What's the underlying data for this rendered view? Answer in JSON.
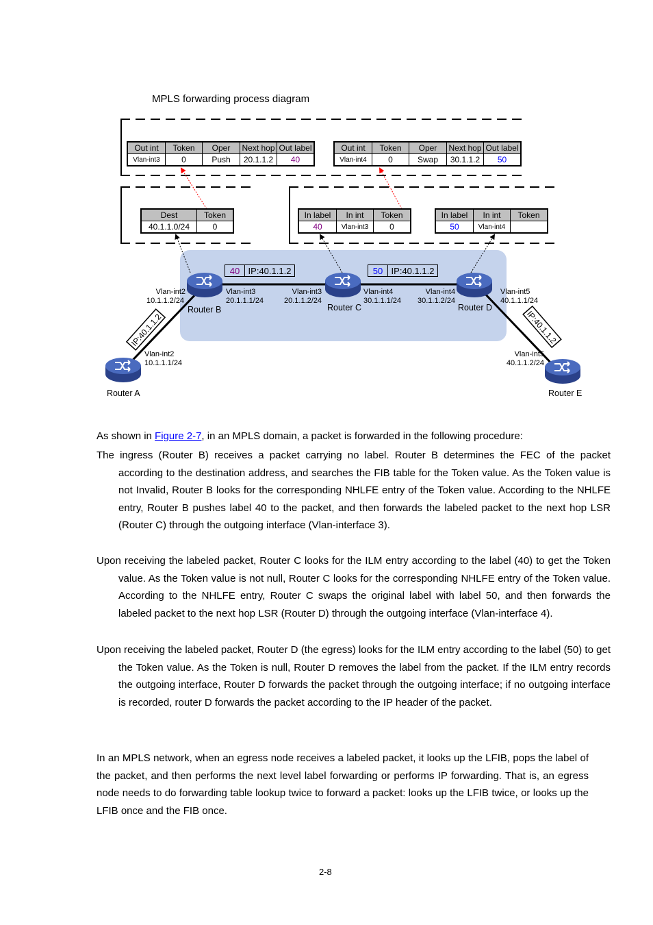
{
  "figure": {
    "caption": "MPLS forwarding process diagram",
    "nhlfe_b": {
      "headers": [
        "Out int",
        "Token",
        "Oper",
        "Next hop",
        "Out label"
      ],
      "row": [
        "Vlan-int3",
        "0",
        "Push",
        "20.1.1.2",
        "40"
      ]
    },
    "nhlfe_c": {
      "headers": [
        "Out int",
        "Token",
        "Oper",
        "Next hop",
        "Out label"
      ],
      "row": [
        "Vlan-int4",
        "0",
        "Swap",
        "30.1.1.2",
        "50"
      ]
    },
    "fib_b": {
      "headers": [
        "Dest",
        "Token"
      ],
      "row": [
        "40.1.1.0/24",
        "0"
      ]
    },
    "ilm_c": {
      "headers": [
        "In label",
        "In int",
        "Token"
      ],
      "row": [
        "40",
        "Vlan-int3",
        "0"
      ]
    },
    "ilm_d": {
      "headers": [
        "In label",
        "In int",
        "Token"
      ],
      "row": [
        "50",
        "Vlan-int4",
        ""
      ]
    },
    "packets": {
      "bc": {
        "label": "40",
        "ip": "IP:40.1.1.2"
      },
      "cd": {
        "label": "50",
        "ip": "IP:40.1.1.2"
      },
      "ab": {
        "ip": "IP:40.1.1.2"
      },
      "de": {
        "ip": "IP:40.1.1.2"
      }
    },
    "routers": {
      "a": {
        "name": "Router A",
        "if": "Vlan-int2",
        "ip": "10.1.1.1/24"
      },
      "b": {
        "name": "Router B",
        "if_left": "Vlan-int2",
        "ip_left": "10.1.1.2/24",
        "if_right": "Vlan-int3",
        "ip_right": "20.1.1.1/24"
      },
      "c": {
        "name": "Router C",
        "if_left": "Vlan-int3",
        "ip_left": "20.1.1.2/24",
        "if_right": "Vlan-int4",
        "ip_right": "30.1.1.1/24"
      },
      "d": {
        "name": "Router D",
        "if_left": "Vlan-int4",
        "ip_left": "30.1.1.2/24",
        "if_right": "Vlan-int5",
        "ip_right": "40.1.1.1/24"
      },
      "e": {
        "name": "Router E",
        "if": "Vlan-int5",
        "ip": "40.1.1.2/24"
      }
    },
    "router_badge": "ROUTER",
    "colors": {
      "domain_bg": "#c5d3ec",
      "router_fill": "#3c5aa8",
      "label40": "#800080",
      "label50": "#0000ff",
      "arrow_red": "#ff0000"
    }
  },
  "text": {
    "intro_before": "As shown in ",
    "intro_link": "Figure 2-7",
    "intro_after": ", in an MPLS domain, a packet is forwarded in the following procedure:",
    "step1": "The ingress (Router B) receives a packet carrying no label. Router B determines the FEC of the packet according to the destination address, and searches the FIB table for the Token value. As the Token value is not Invalid, Router B looks for the corresponding NHLFE entry of the Token value. According to the NHLFE entry, Router B pushes label 40 to the packet, and then forwards the labeled packet to the next hop LSR (Router C) through the outgoing interface (Vlan-interface 3).",
    "step2": "Upon receiving the labeled packet, Router C looks for the ILM entry according to the label (40) to get the Token value. As the Token value is not null, Router C looks for the corresponding NHLFE entry of the Token value. According to the NHLFE entry, Router C swaps the original label with label 50, and then forwards the labeled packet to the next hop LSR (Router D) through the outgoing interface (Vlan-interface 4).",
    "step3": "Upon receiving the labeled packet, Router D (the egress) looks for the ILM entry according to the label (50) to get the Token value. As the Token is null, Router D removes the label from the packet. If the ILM entry records the outgoing interface, Router D forwards the packet through the outgoing interface; if no outgoing interface is recorded, router D forwards the packet according to the IP header of the packet.",
    "para2": "In an MPLS network, when an egress node receives a labeled packet, it looks up the LFIB, pops the label of the packet, and then performs the next level label forwarding or performs IP forwarding. That is, an egress node needs to do forwarding table lookup twice to forward a packet: looks up the LFIB twice, or looks up the LFIB once and the FIB once."
  },
  "footer": {
    "page": "2-8"
  }
}
